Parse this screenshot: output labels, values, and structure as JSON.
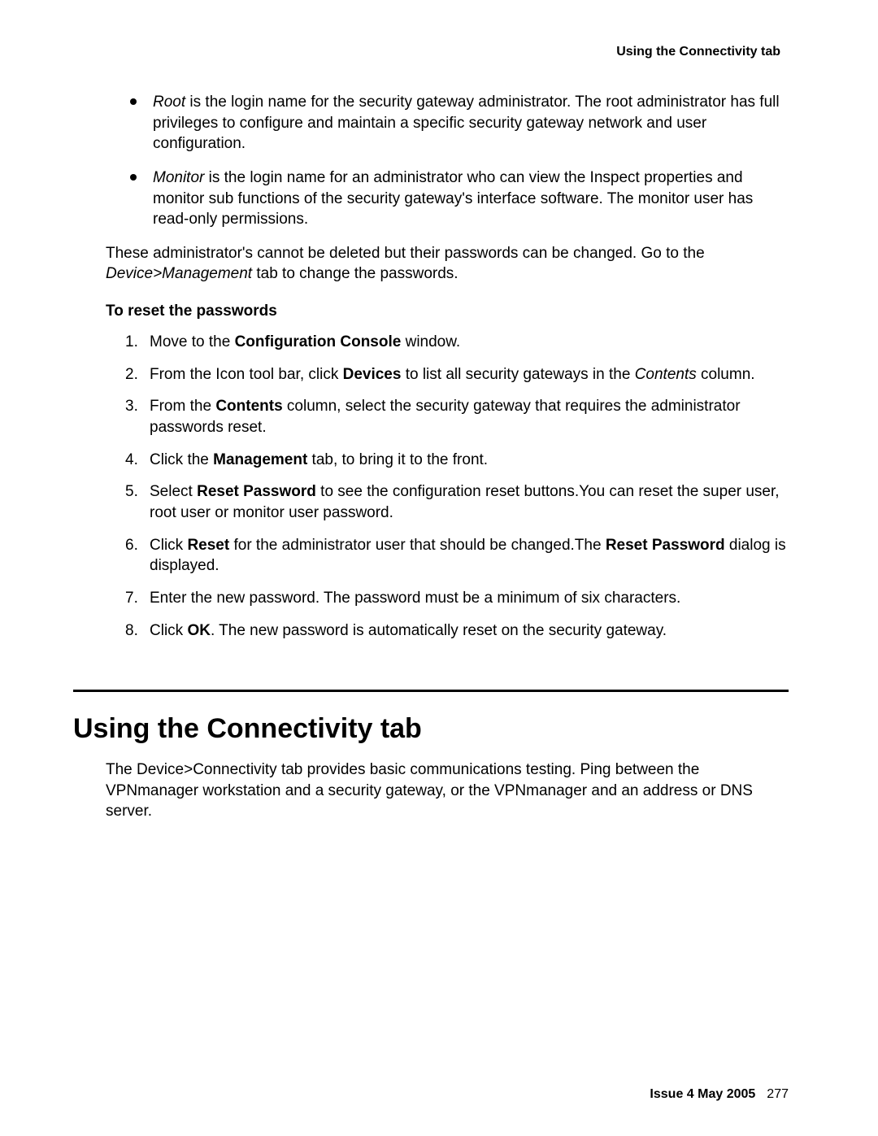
{
  "running_head": "Using the Connectivity tab",
  "bullets": {
    "root": {
      "term": "Root",
      "rest": " is the login name for the security gateway administrator. The root administrator has full privileges to configure and maintain a specific security gateway network and user configuration."
    },
    "monitor": {
      "term": "Monitor",
      "rest": " is the login name for an administrator who can view the Inspect properties and monitor sub functions of the security gateway's interface software. The monitor user has read-only permissions."
    }
  },
  "para1": {
    "lead": "These administrator's cannot be deleted but their passwords can be changed. Go to the ",
    "ital": "Device>Management",
    "trail": " tab to change the passwords."
  },
  "sub_head": "To reset the passwords",
  "steps": {
    "s1": {
      "a": "Move to the ",
      "b": "Configuration Console",
      "c": " window."
    },
    "s2": {
      "a": "From the Icon tool bar, click ",
      "b": "Devices",
      "c": " to list all security gateways in the ",
      "d": "Contents",
      "e": " column."
    },
    "s3": {
      "a": "From the ",
      "b": "Contents",
      "c": " column, select the security gateway that requires the administrator passwords reset."
    },
    "s4": {
      "a": "Click the ",
      "b": "Management",
      "c": " tab, to bring it to the front."
    },
    "s5": {
      "a": "Select ",
      "b": "Reset Password",
      "c": " to see the configuration reset buttons.You can reset the super user, root user or monitor user password."
    },
    "s6": {
      "a": "Click ",
      "b": "Reset",
      "c": " for the administrator user that should be changed.The ",
      "d": "Reset Password",
      "e": " dialog is displayed."
    },
    "s7": {
      "a": "Enter the new password. The password must be a minimum of six characters."
    },
    "s8": {
      "a": "Click ",
      "b": "OK",
      "c": ". The new password is automatically reset on the security gateway."
    }
  },
  "section_title": "Using the Connectivity tab",
  "section_para": "The Device>Connectivity tab provides basic communications testing. Ping between the VPNmanager workstation and a security gateway, or the VPNmanager and an address or DNS server.",
  "footer": {
    "issue": "Issue 4   May 2005",
    "page": "277"
  }
}
